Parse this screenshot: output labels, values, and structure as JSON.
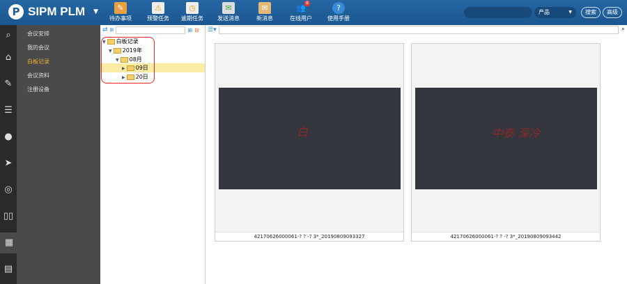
{
  "header": {
    "logo_letter": "P",
    "title": "SIPM PLM",
    "dropdown": "▼",
    "nav": [
      {
        "label": "待办事项",
        "icon": "todo-icon"
      },
      {
        "label": "预警任务",
        "icon": "warning-task-icon"
      },
      {
        "label": "逾期任务",
        "icon": "overdue-task-icon"
      },
      {
        "label": "发送消息",
        "icon": "send-message-icon"
      },
      {
        "label": "新消息",
        "icon": "new-message-icon"
      },
      {
        "label": "在线用户",
        "icon": "online-users-icon",
        "badge": "8"
      },
      {
        "label": "使用手册",
        "icon": "help-manual-icon"
      }
    ],
    "search_placeholder": "",
    "select_value": "产品",
    "search_btn": "搜索",
    "advanced_btn": "高级"
  },
  "sidebar": {
    "items": [
      {
        "label": "会议安排"
      },
      {
        "label": "我的会议"
      },
      {
        "label": "白板记录",
        "active": true
      },
      {
        "label": "会议资料"
      },
      {
        "label": "注册设备"
      }
    ]
  },
  "tree": {
    "root": "白板记录",
    "year": "2019年",
    "month": "08月",
    "days": [
      "09日",
      "20日"
    ]
  },
  "cards": [
    {
      "caption": "42170626000061-? ? -? 3*_20190809093327",
      "handwriting": "白"
    },
    {
      "caption": "42170626000061-? ? -? 3*_20190809093442",
      "handwriting": "中泰 深冷"
    }
  ],
  "colors": {
    "header": "#1f5d96",
    "active": "#f0b030",
    "highlight": "#fbeca5"
  }
}
